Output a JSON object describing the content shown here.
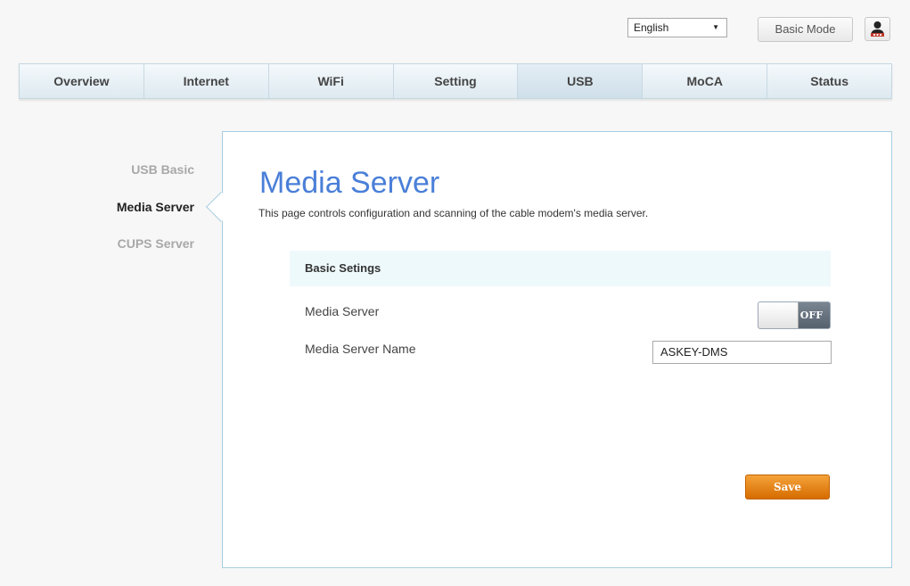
{
  "header": {
    "language": "English",
    "mode_button": "Basic Mode",
    "user_icon": "user-icon"
  },
  "nav": {
    "tabs": [
      {
        "label": "Overview"
      },
      {
        "label": "Internet"
      },
      {
        "label": "WiFi"
      },
      {
        "label": "Setting"
      },
      {
        "label": "USB"
      },
      {
        "label": "MoCA"
      },
      {
        "label": "Status"
      }
    ],
    "active": "USB"
  },
  "sidebar": {
    "items": [
      {
        "label": "USB Basic"
      },
      {
        "label": "Media Server"
      },
      {
        "label": "CUPS Server"
      }
    ],
    "active": "Media Server"
  },
  "main": {
    "title": "Media Server",
    "description": "This page controls configuration and scanning of the cable modem's media server.",
    "section_title": "Basic Setings",
    "media_server_label": "Media Server",
    "media_server_state": "OFF",
    "media_server_name_label": "Media Server Name",
    "media_server_name_value": "ASKEY-DMS",
    "save_label": "Save"
  },
  "colors": {
    "accent_title": "#4a7fd8",
    "save_button": "#e8830d",
    "panel_border": "#a8cde0"
  }
}
